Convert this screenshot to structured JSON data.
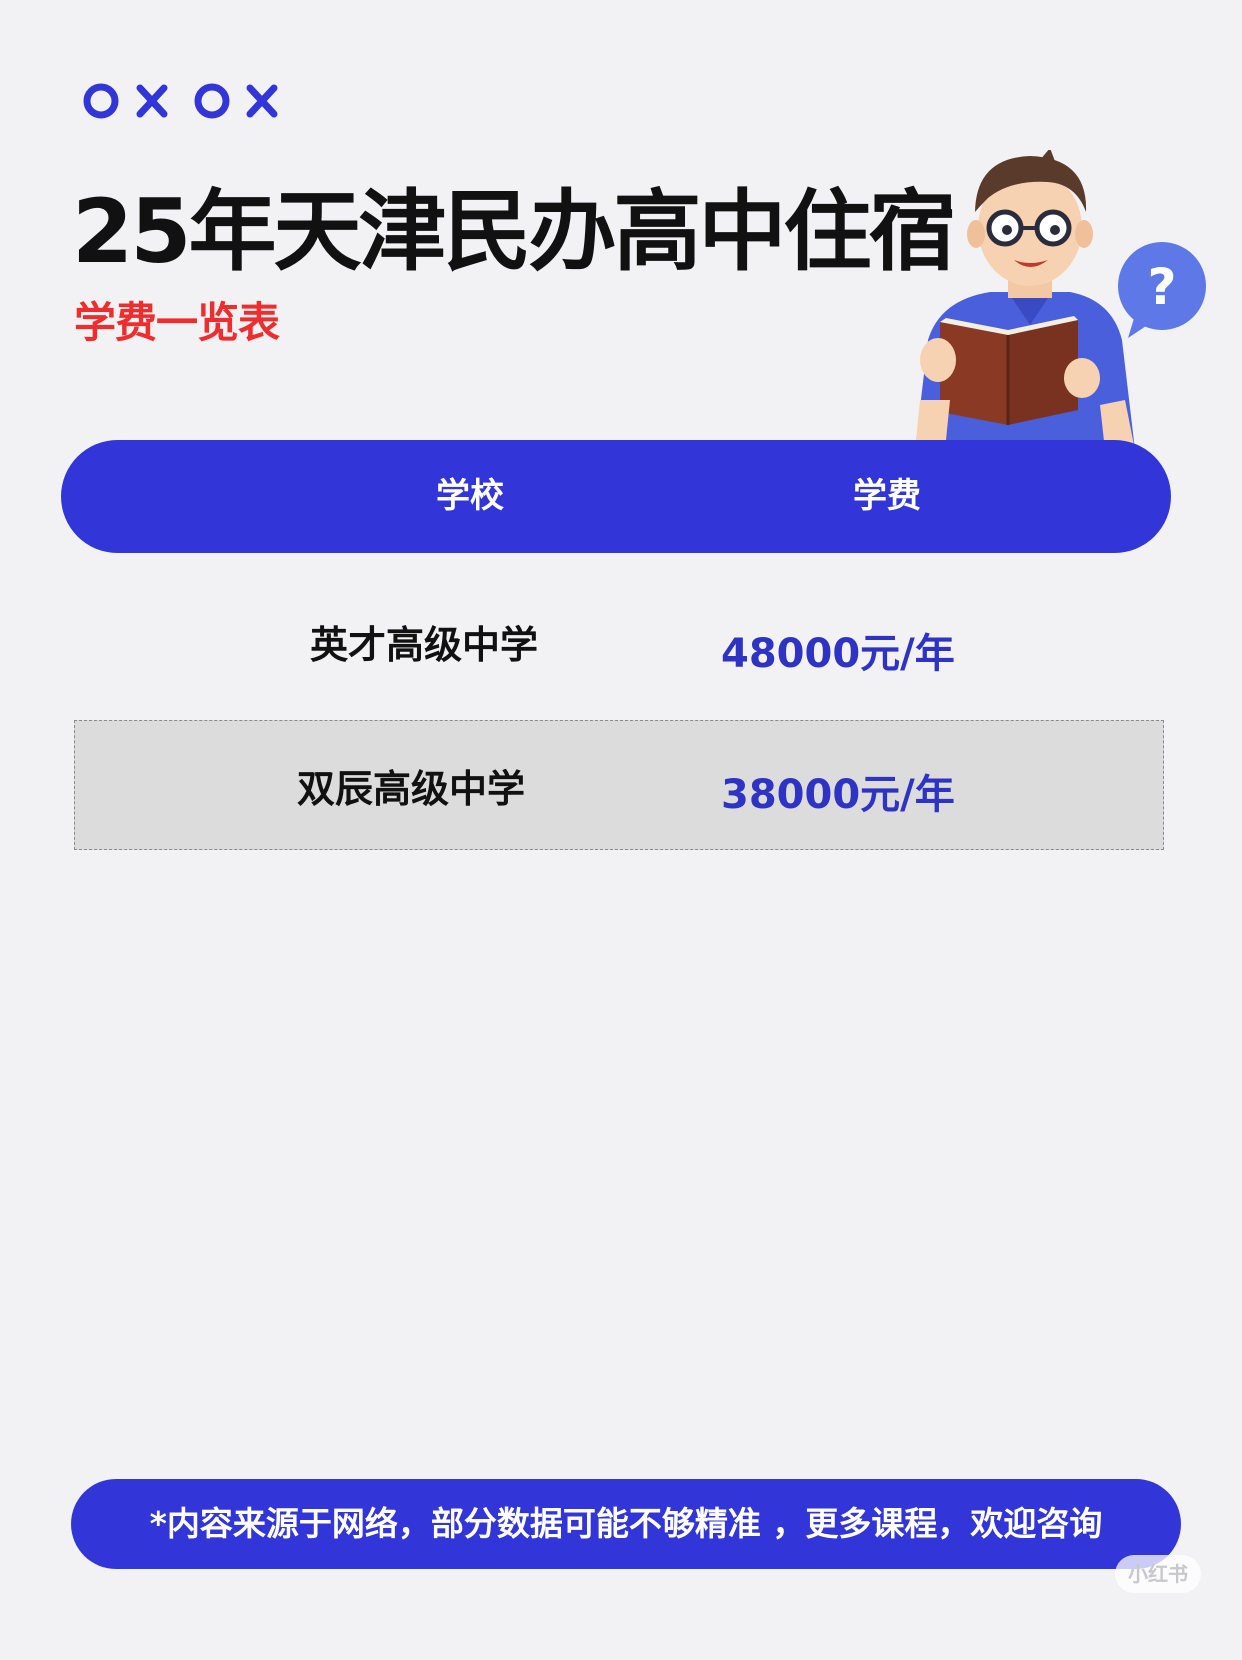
{
  "header": {
    "title": "25年天津民办高中住宿",
    "subtitle": "学费一览表"
  },
  "decoration": {
    "icons": [
      "circle-icon",
      "cross-icon",
      "circle-icon",
      "cross-icon"
    ]
  },
  "illustration": {
    "icon": "student-reading-book-icon",
    "bubble_text": "?"
  },
  "table": {
    "headers": {
      "school": "学校",
      "fee": "学费"
    },
    "rows": [
      {
        "school": "英才高级中学",
        "fee": "48000元/年"
      },
      {
        "school": "双辰高级中学",
        "fee": "38000元/年"
      }
    ]
  },
  "footer": {
    "note": "*内容来源于网络，部分数据可能不够精准 ，更多课程，欢迎咨询"
  },
  "watermark": {
    "text": "小红书"
  },
  "colors": {
    "accent": "#3236d8",
    "subtitle": "#ee2e2e",
    "fee_text": "#2e33c4",
    "background": "#f2f2f5",
    "alt_row": "#dcdcdc"
  }
}
